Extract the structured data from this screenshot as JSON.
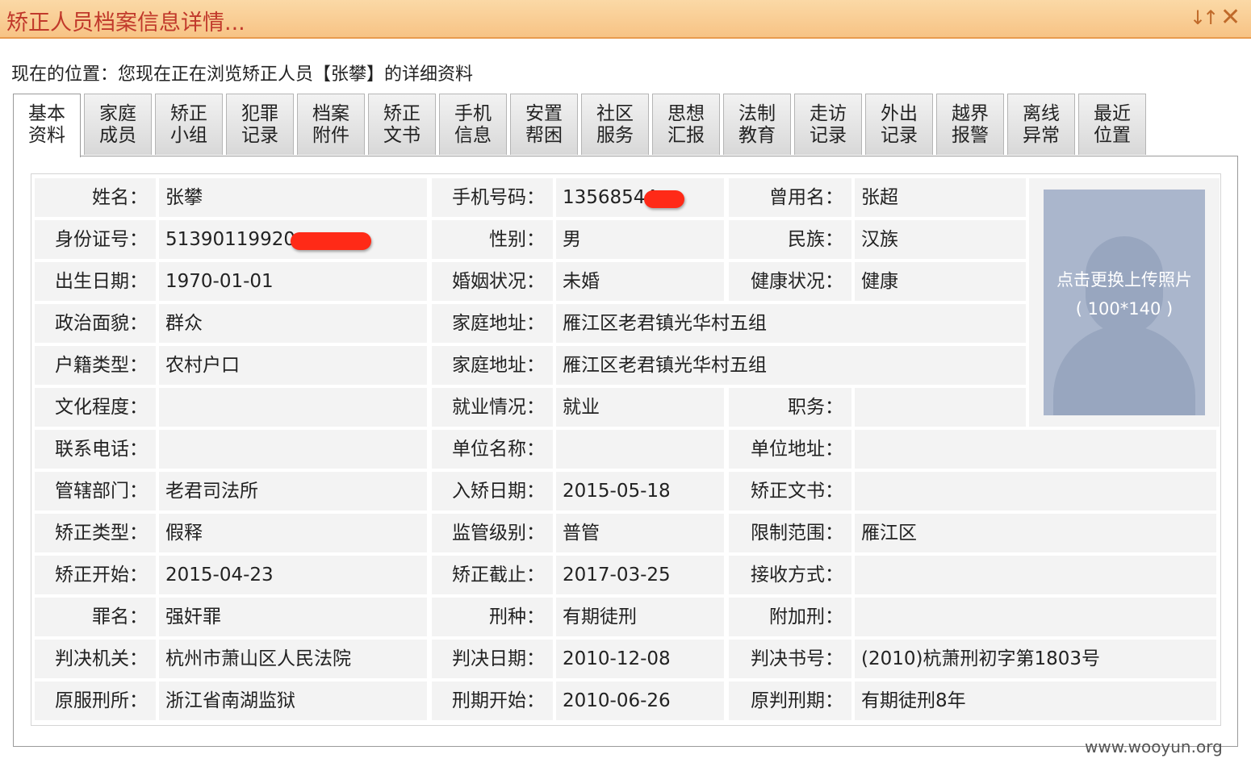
{
  "window": {
    "title": "矫正人员档案信息详情...",
    "sort_icon": "sort-icon",
    "close_icon": "close-icon"
  },
  "location_text": "现在的位置：您现在正在浏览矫正人员【张攀】的详细资料",
  "tabs": [
    {
      "line1": "基本",
      "line2": "资料",
      "active": true
    },
    {
      "line1": "家庭",
      "line2": "成员"
    },
    {
      "line1": "矫正",
      "line2": "小组"
    },
    {
      "line1": "犯罪",
      "line2": "记录"
    },
    {
      "line1": "档案",
      "line2": "附件"
    },
    {
      "line1": "矫正",
      "line2": "文书"
    },
    {
      "line1": "手机",
      "line2": "信息"
    },
    {
      "line1": "安置",
      "line2": "帮困"
    },
    {
      "line1": "社区",
      "line2": "服务"
    },
    {
      "line1": "思想",
      "line2": "汇报"
    },
    {
      "line1": "法制",
      "line2": "教育"
    },
    {
      "line1": "走访",
      "line2": "记录"
    },
    {
      "line1": "外出",
      "line2": "记录"
    },
    {
      "line1": "越界",
      "line2": "报警"
    },
    {
      "line1": "离线",
      "line2": "异常"
    },
    {
      "line1": "最近",
      "line2": "位置"
    }
  ],
  "rows": [
    [
      {
        "label": "姓名：",
        "value": "张攀"
      },
      {
        "label": "手机号码：",
        "value": "13568544"
      },
      {
        "label": "曾用名：",
        "value": "张超"
      }
    ],
    [
      {
        "label": "身份证号：",
        "value": "51390119920"
      },
      {
        "label": "性别：",
        "value": "男"
      },
      {
        "label": "民族：",
        "value": "汉族"
      }
    ],
    [
      {
        "label": "出生日期：",
        "value": "1970-01-01"
      },
      {
        "label": "婚姻状况：",
        "value": "未婚"
      },
      {
        "label": "健康状况：",
        "value": "健康"
      }
    ],
    [
      {
        "label": "政治面貌：",
        "value": "群众"
      },
      {
        "label": "家庭地址：",
        "value": "雁江区老君镇光华村五组"
      }
    ],
    [
      {
        "label": "户籍类型：",
        "value": "农村户口"
      },
      {
        "label": "家庭地址：",
        "value": "雁江区老君镇光华村五组"
      }
    ],
    [
      {
        "label": "文化程度：",
        "value": ""
      },
      {
        "label": "就业情况：",
        "value": "就业"
      },
      {
        "label": "职务：",
        "value": ""
      }
    ],
    [
      {
        "label": "联系电话：",
        "value": ""
      },
      {
        "label": "单位名称：",
        "value": ""
      },
      {
        "label": "单位地址：",
        "value": ""
      }
    ],
    [
      {
        "label": "管辖部门：",
        "value": "老君司法所"
      },
      {
        "label": "入矫日期：",
        "value": "2015-05-18"
      },
      {
        "label": "矫正文书：",
        "value": ""
      }
    ],
    [
      {
        "label": "矫正类型：",
        "value": "假释"
      },
      {
        "label": "监管级别：",
        "value": "普管"
      },
      {
        "label": "限制范围：",
        "value": "雁江区"
      }
    ],
    [
      {
        "label": "矫正开始：",
        "value": "2015-04-23"
      },
      {
        "label": "矫正截止：",
        "value": "2017-03-25"
      },
      {
        "label": "接收方式：",
        "value": ""
      }
    ],
    [
      {
        "label": "罪名：",
        "value": "强奸罪"
      },
      {
        "label": "刑种：",
        "value": "有期徒刑"
      },
      {
        "label": "附加刑：",
        "value": ""
      }
    ],
    [
      {
        "label": "判决机关：",
        "value": "杭州市萧山区人民法院"
      },
      {
        "label": "判决日期：",
        "value": "2010-12-08"
      },
      {
        "label": "判决书号：",
        "value": "(2010)杭萧刑初字第1803号"
      }
    ],
    [
      {
        "label": "原服刑所：",
        "value": "浙江省南湖监狱"
      },
      {
        "label": "刑期开始：",
        "value": "2010-06-26"
      },
      {
        "label": "原判刑期：",
        "value": "有期徒刑8年"
      }
    ]
  ],
  "photo": {
    "line1": "点击更换上传照片",
    "line2": "( 100*140 )"
  },
  "colors": {
    "title_text": "#c1392b",
    "titlebar_bg": "#f7c385",
    "cell_bg": "#f3f3f3",
    "redaction": "#ff2a17"
  },
  "watermark": "www.wooyun.org"
}
